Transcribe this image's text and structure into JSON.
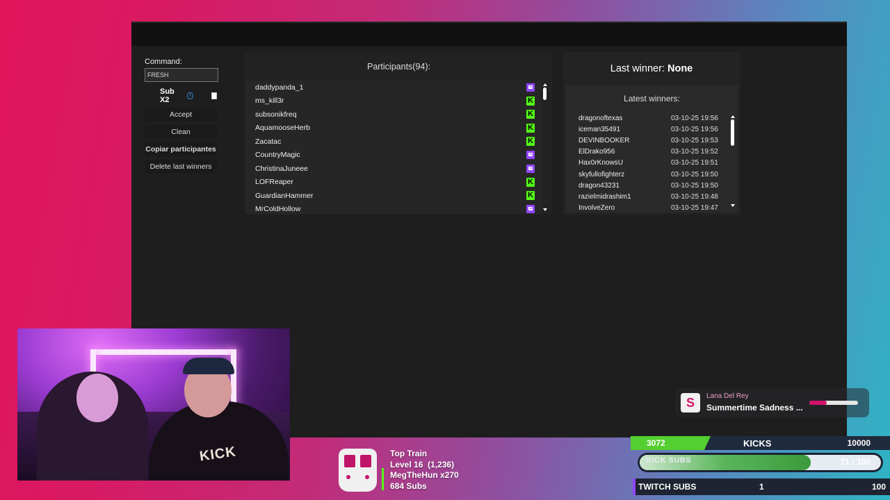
{
  "command": {
    "label": "Command:",
    "value": "FRESH"
  },
  "sub_x2": {
    "label": "Sub X2",
    "info_icon": "info-icon",
    "checked": false
  },
  "buttons": {
    "accept": "Accept",
    "clean": "Clean",
    "copy_participants": "Copiar participantes",
    "delete_last_winners": "Delete last winners"
  },
  "participants": {
    "title": "Participants(94):",
    "items": [
      {
        "name": "daddypanda_1",
        "platform": "twitch"
      },
      {
        "name": "ms_kill3r",
        "platform": "kick"
      },
      {
        "name": "subsonikfreq",
        "platform": "kick"
      },
      {
        "name": "AquamooseHerb",
        "platform": "kick"
      },
      {
        "name": "Zacatac",
        "platform": "kick"
      },
      {
        "name": "CountryMagic",
        "platform": "twitch"
      },
      {
        "name": "ChristinaJuneee",
        "platform": "twitch"
      },
      {
        "name": "LOFReaper",
        "platform": "kick"
      },
      {
        "name": "GuardianHammer",
        "platform": "kick"
      },
      {
        "name": "MrColdHollow",
        "platform": "twitch"
      }
    ]
  },
  "last_winner": {
    "label": "Last winner:",
    "value": "None"
  },
  "latest_winners": {
    "title": "Latest winners:",
    "items": [
      {
        "name": "dragonoftexas",
        "time": "03-10-25 19:56"
      },
      {
        "name": "iceman35491",
        "time": "03-10-25 19:56"
      },
      {
        "name": "DEVINBOOKER",
        "time": "03-10-25 19:53"
      },
      {
        "name": "ElDrako956",
        "time": "03-10-25 19:52"
      },
      {
        "name": "Hax0rKnowsU",
        "time": "03-10-25 19:51"
      },
      {
        "name": "skyfullofighterz",
        "time": "03-10-25 19:50"
      },
      {
        "name": "dragon43231",
        "time": "03-10-25 19:50"
      },
      {
        "name": "razielmidrashim1",
        "time": "03-10-25 19:48"
      },
      {
        "name": "InvolveZero",
        "time": "03-10-25 19:47"
      }
    ]
  },
  "top_train": {
    "title": "Top Train",
    "level": "Level 16",
    "level_count": "(1,236)",
    "user": "MegTheHun x270",
    "subs": "684 Subs"
  },
  "now_playing": {
    "artist": "Lana Del Rey",
    "title": "Summertime Sadness ...",
    "progress": 0.35
  },
  "goals": {
    "kicks": {
      "current": "3072",
      "label": "KICKS",
      "max": "10000",
      "progress": 0.307
    },
    "kick_subs": {
      "label": "KICK SUBS",
      "value": "71 / 100",
      "progress": 0.71
    },
    "twitch_subs": {
      "label": "TWITCH SUBS",
      "current": "1",
      "max": "100"
    }
  },
  "colors": {
    "kick_green": "#53fc18",
    "twitch_purple": "#9146ff",
    "panel_bg": "#1e1e1e"
  }
}
